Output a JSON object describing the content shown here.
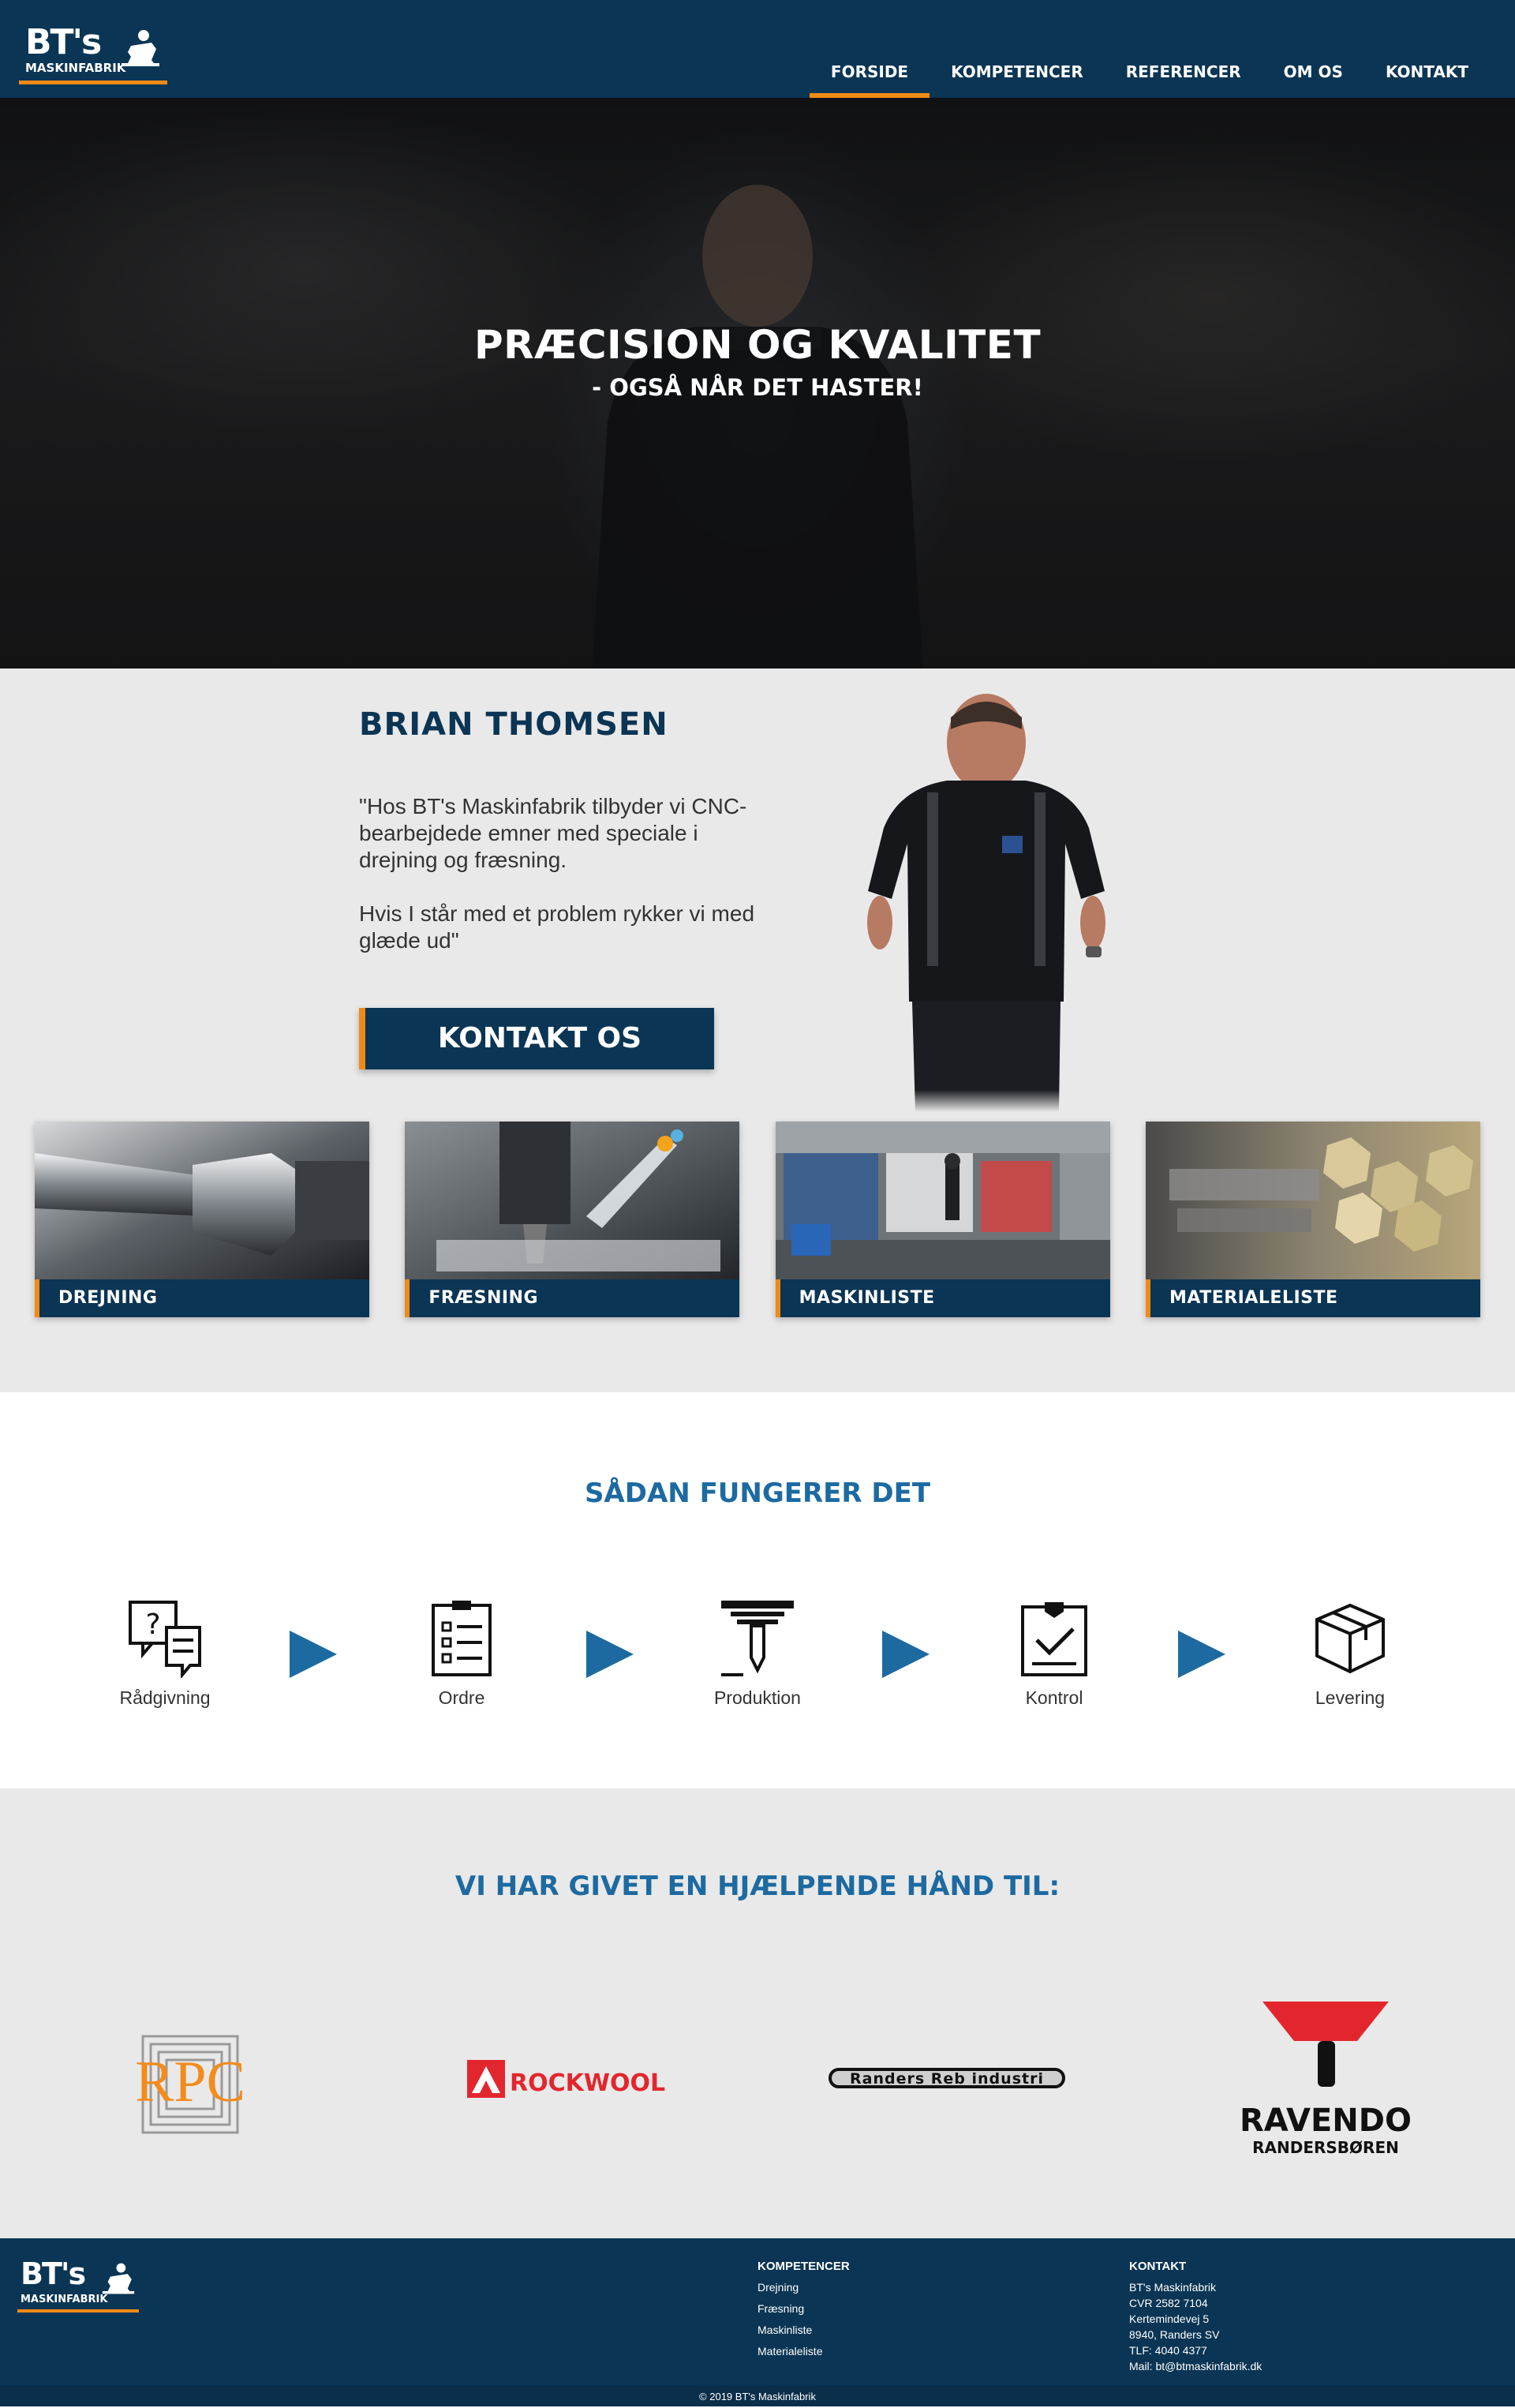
{
  "brand": {
    "name": "BT's",
    "sub": "MASKINFABRIK"
  },
  "nav": [
    {
      "label": "FORSIDE",
      "active": true
    },
    {
      "label": "KOMPETENCER",
      "active": false
    },
    {
      "label": "REFERENCER",
      "active": false
    },
    {
      "label": "OM OS",
      "active": false
    },
    {
      "label": "KONTAKT",
      "active": false
    }
  ],
  "hero": {
    "title": "PRÆCISION OG KVALITET",
    "subtitle": "- OGSÅ NÅR DET HASTER!"
  },
  "profile": {
    "name": "BRIAN THOMSEN",
    "quote_1": "\"Hos BT's Maskinfabrik tilbyder vi CNC-bearbejdede emner med speciale i drejning og fræsning.",
    "quote_2": "Hvis I står med et problem rykker vi med glæde ud\"",
    "button": "KONTAKT OS"
  },
  "cards": [
    {
      "label": "DREJNING"
    },
    {
      "label": "FRÆSNING"
    },
    {
      "label": "MASKINLISTE"
    },
    {
      "label": "MATERIALELISTE"
    }
  ],
  "process": {
    "title": "SÅDAN FUNGERER DET",
    "steps": [
      {
        "label": "Rådgivning",
        "icon": "advice-icon"
      },
      {
        "label": "Ordre",
        "icon": "order-icon"
      },
      {
        "label": "Produktion",
        "icon": "production-icon"
      },
      {
        "label": "Kontrol",
        "icon": "control-icon"
      },
      {
        "label": "Levering",
        "icon": "delivery-icon"
      }
    ]
  },
  "clients": {
    "title": "VI HAR GIVET EN HJÆLPENDE HÅND TIL:",
    "logos": {
      "rpc": "RPC",
      "rockwool": "ROCKWOOL",
      "randers": "Randers Reb industri",
      "ravendo": "RAVENDO",
      "ravendo_sub": "RANDERSBØREN"
    }
  },
  "footer": {
    "competences_title": "KOMPETENCER",
    "competences": [
      "Drejning",
      "Fræsning",
      "Maskinliste",
      "Materialeliste"
    ],
    "contact_title": "KONTAKT",
    "contact": [
      "BT's Maskinfabrik",
      "CVR 2582 7104",
      "Kertemindevej 5",
      "8940, Randers SV",
      "TLF: 4040 4377",
      "Mail: bt@btmaskinfabrik.dk"
    ],
    "copyright": "© 2019 BT's Maskinfabrik"
  },
  "colors": {
    "navy": "#0b3554",
    "orange": "#ef8a17",
    "blue": "#1d6aa1",
    "section_gray": "#e9e9e9"
  }
}
